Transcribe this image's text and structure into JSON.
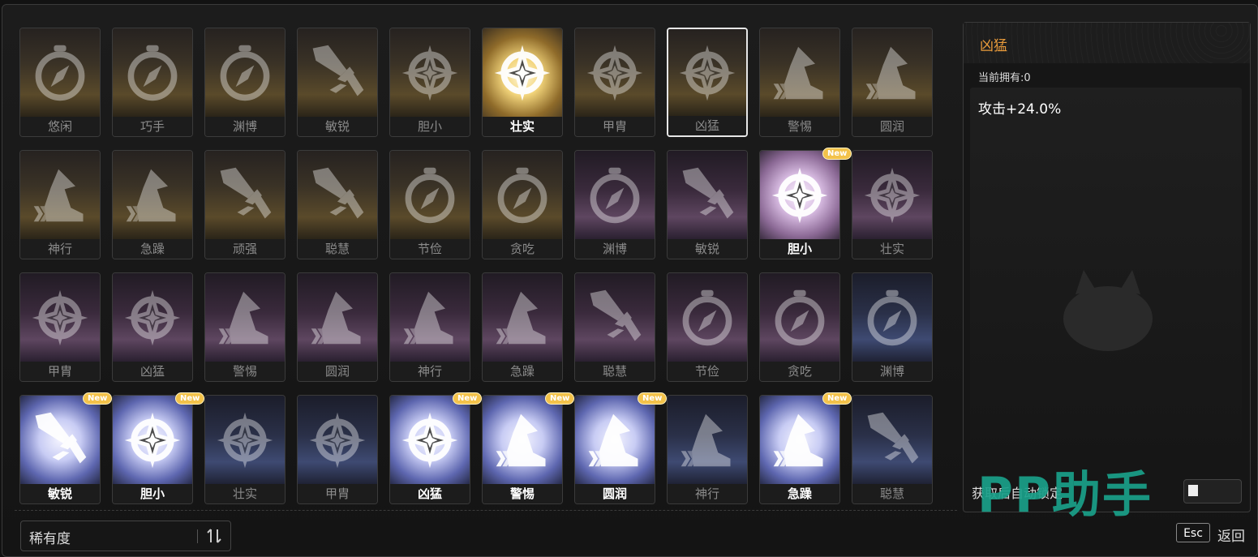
{
  "colors": {
    "accent": "#e99b3b",
    "new_badge": "#f3c24a",
    "watermark": "#1aa08a"
  },
  "cards": [
    {
      "label": "悠闲",
      "icon": "compass-icon",
      "tier": "gold",
      "bright": false,
      "selected": false,
      "is_new": false
    },
    {
      "label": "巧手",
      "icon": "compass-icon",
      "tier": "gold",
      "bright": false,
      "selected": false,
      "is_new": false
    },
    {
      "label": "渊博",
      "icon": "compass-icon",
      "tier": "gold",
      "bright": false,
      "selected": false,
      "is_new": false
    },
    {
      "label": "敏锐",
      "icon": "sword-icon",
      "tier": "gold",
      "bright": false,
      "selected": false,
      "is_new": false
    },
    {
      "label": "胆小",
      "icon": "star-emblem-icon",
      "tier": "gold",
      "bright": false,
      "selected": false,
      "is_new": false
    },
    {
      "label": "壮实",
      "icon": "star-emblem-icon",
      "tier": "gold",
      "bright": true,
      "selected": false,
      "is_new": false
    },
    {
      "label": "甲胄",
      "icon": "star-emblem-icon",
      "tier": "gold",
      "bright": false,
      "selected": false,
      "is_new": false
    },
    {
      "label": "凶猛",
      "icon": "star-emblem-icon",
      "tier": "gold",
      "bright": false,
      "selected": true,
      "is_new": false
    },
    {
      "label": "警惕",
      "icon": "boot-icon",
      "tier": "gold",
      "bright": false,
      "selected": false,
      "is_new": false
    },
    {
      "label": "圆润",
      "icon": "boot-icon",
      "tier": "gold",
      "bright": false,
      "selected": false,
      "is_new": false
    },
    {
      "label": "神行",
      "icon": "boot-icon",
      "tier": "gold",
      "bright": false,
      "selected": false,
      "is_new": false
    },
    {
      "label": "急躁",
      "icon": "boot-icon",
      "tier": "gold",
      "bright": false,
      "selected": false,
      "is_new": false
    },
    {
      "label": "顽强",
      "icon": "sword-icon",
      "tier": "gold",
      "bright": false,
      "selected": false,
      "is_new": false
    },
    {
      "label": "聪慧",
      "icon": "sword-icon",
      "tier": "gold",
      "bright": false,
      "selected": false,
      "is_new": false
    },
    {
      "label": "节俭",
      "icon": "compass-icon",
      "tier": "gold",
      "bright": false,
      "selected": false,
      "is_new": false
    },
    {
      "label": "贪吃",
      "icon": "compass-icon",
      "tier": "gold",
      "bright": false,
      "selected": false,
      "is_new": false
    },
    {
      "label": "渊博",
      "icon": "compass-icon",
      "tier": "purple",
      "bright": false,
      "selected": false,
      "is_new": false
    },
    {
      "label": "敏锐",
      "icon": "sword-icon",
      "tier": "purple",
      "bright": false,
      "selected": false,
      "is_new": false
    },
    {
      "label": "胆小",
      "icon": "star-emblem-icon",
      "tier": "purple",
      "bright": true,
      "selected": false,
      "is_new": true
    },
    {
      "label": "壮实",
      "icon": "star-emblem-icon",
      "tier": "purple",
      "bright": false,
      "selected": false,
      "is_new": false
    },
    {
      "label": "甲胄",
      "icon": "star-emblem-icon",
      "tier": "purple",
      "bright": false,
      "selected": false,
      "is_new": false
    },
    {
      "label": "凶猛",
      "icon": "star-emblem-icon",
      "tier": "purple",
      "bright": false,
      "selected": false,
      "is_new": false
    },
    {
      "label": "警惕",
      "icon": "boot-icon",
      "tier": "purple",
      "bright": false,
      "selected": false,
      "is_new": false
    },
    {
      "label": "圆润",
      "icon": "boot-icon",
      "tier": "purple",
      "bright": false,
      "selected": false,
      "is_new": false
    },
    {
      "label": "神行",
      "icon": "boot-icon",
      "tier": "purple",
      "bright": false,
      "selected": false,
      "is_new": false
    },
    {
      "label": "急躁",
      "icon": "boot-icon",
      "tier": "purple",
      "bright": false,
      "selected": false,
      "is_new": false
    },
    {
      "label": "聪慧",
      "icon": "sword-icon",
      "tier": "purple",
      "bright": false,
      "selected": false,
      "is_new": false
    },
    {
      "label": "节俭",
      "icon": "compass-icon",
      "tier": "purple",
      "bright": false,
      "selected": false,
      "is_new": false
    },
    {
      "label": "贪吃",
      "icon": "compass-icon",
      "tier": "purple",
      "bright": false,
      "selected": false,
      "is_new": false
    },
    {
      "label": "渊博",
      "icon": "compass-icon",
      "tier": "blue",
      "bright": false,
      "selected": false,
      "is_new": false
    },
    {
      "label": "敏锐",
      "icon": "sword-icon",
      "tier": "blue",
      "bright": true,
      "selected": false,
      "is_new": true
    },
    {
      "label": "胆小",
      "icon": "star-emblem-icon",
      "tier": "blue",
      "bright": true,
      "selected": false,
      "is_new": true
    },
    {
      "label": "壮实",
      "icon": "star-emblem-icon",
      "tier": "blue",
      "bright": false,
      "selected": false,
      "is_new": false
    },
    {
      "label": "甲胄",
      "icon": "star-emblem-icon",
      "tier": "blue",
      "bright": false,
      "selected": false,
      "is_new": false
    },
    {
      "label": "凶猛",
      "icon": "star-emblem-icon",
      "tier": "blue",
      "bright": true,
      "selected": false,
      "is_new": true
    },
    {
      "label": "警惕",
      "icon": "boot-icon",
      "tier": "blue",
      "bright": true,
      "selected": false,
      "is_new": true
    },
    {
      "label": "圆润",
      "icon": "boot-icon",
      "tier": "blue",
      "bright": true,
      "selected": false,
      "is_new": true
    },
    {
      "label": "神行",
      "icon": "boot-icon",
      "tier": "blue",
      "bright": false,
      "selected": false,
      "is_new": false
    },
    {
      "label": "急躁",
      "icon": "boot-icon",
      "tier": "blue",
      "bright": true,
      "selected": false,
      "is_new": true
    },
    {
      "label": "聪慧",
      "icon": "sword-icon",
      "tier": "blue",
      "bright": false,
      "selected": false,
      "is_new": false
    }
  ],
  "new_badge_label": "New",
  "detail": {
    "title": "凶猛",
    "owned": "当前拥有:0",
    "effect": "攻击+24.0%",
    "auto_lock_label": "获取后自动锁定"
  },
  "sort": {
    "label": "稀有度",
    "icon": "sort-icon"
  },
  "footer": {
    "esc_key": "Esc",
    "back_label": "返回"
  },
  "watermark": "PP助手"
}
